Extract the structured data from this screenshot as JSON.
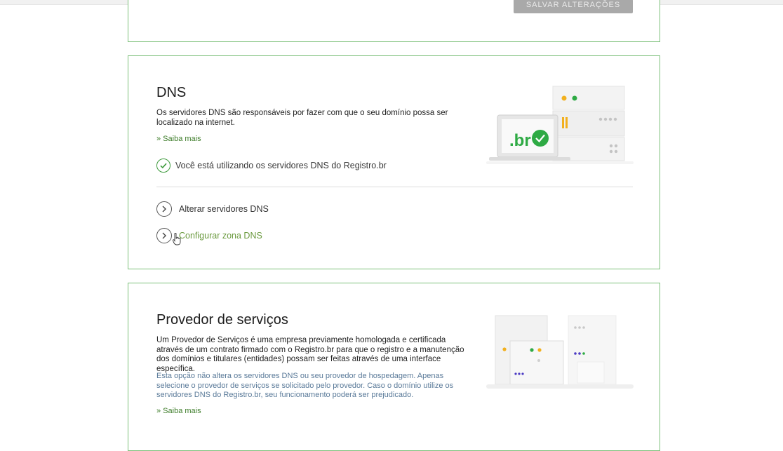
{
  "save_section": {
    "save_label": "SALVAR ALTERAÇÕES"
  },
  "dns": {
    "title": "DNS",
    "description": "Os servidores DNS são responsáveis por fazer com que o seu domínio possa ser localizado na internet.",
    "learn_more": "» Saiba mais",
    "status": "Você está utilizando os servidores DNS do Registro.br",
    "actions": [
      {
        "label": "Alterar servidores DNS"
      },
      {
        "label": "Configurar zona DNS"
      }
    ],
    "illustration_text": ".br"
  },
  "provider": {
    "title": "Provedor de serviços",
    "description": "Um Provedor de Serviços é uma empresa previamente homologada e certificada através de um contrato firmado com o Registro.br para que o registro e a manutenção dos domínios e titulares (entidades) possam ser feitas através de uma interface específica.",
    "note": "Esta opção não altera os servidores DNS ou seu provedor de hospedagem. Apenas selecione o provedor de serviços se solicitado pelo provedor. Caso o domínio utilize os servidores DNS do Registro.br, seu funcionamento poderá ser prejudicado.",
    "learn_more": "» Saiba mais"
  },
  "colors": {
    "border": "#7cc07a",
    "accent": "#3c9a3b",
    "link": "#3e7d2a"
  }
}
